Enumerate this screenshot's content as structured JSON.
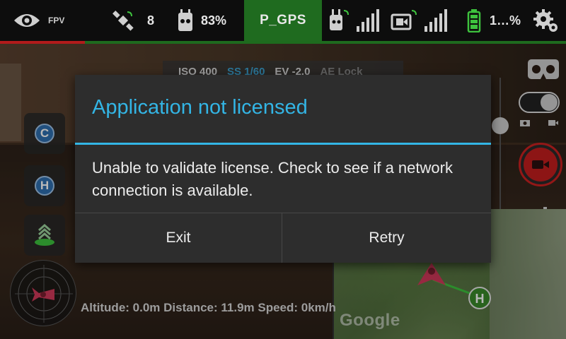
{
  "topbar": {
    "fpv_label": "FPV",
    "satellite_count": "8",
    "remote_battery": "83%",
    "flight_mode": "P_GPS",
    "drone_battery": "1…%"
  },
  "exposure": {
    "iso": "ISO 400",
    "shutter": "SS 1/60",
    "ev": "EV -2.0",
    "ae": "AE Lock"
  },
  "left_buttons": {
    "camera_mode_label": "C",
    "home_label": "H"
  },
  "status_line": "Altitude: 0.0m Distance: 11.9m Speed: 0km/h",
  "map": {
    "watermark": "Google",
    "home_marker_label": "H"
  },
  "dialog": {
    "title": "Application not licensed",
    "message": "Unable to validate license. Check to see if a network connection is available.",
    "exit_label": "Exit",
    "retry_label": "Retry"
  },
  "colors": {
    "accent": "#33b5e5",
    "flight_mode_bg": "#1f6b1f",
    "record_red": "#c41e1e"
  }
}
